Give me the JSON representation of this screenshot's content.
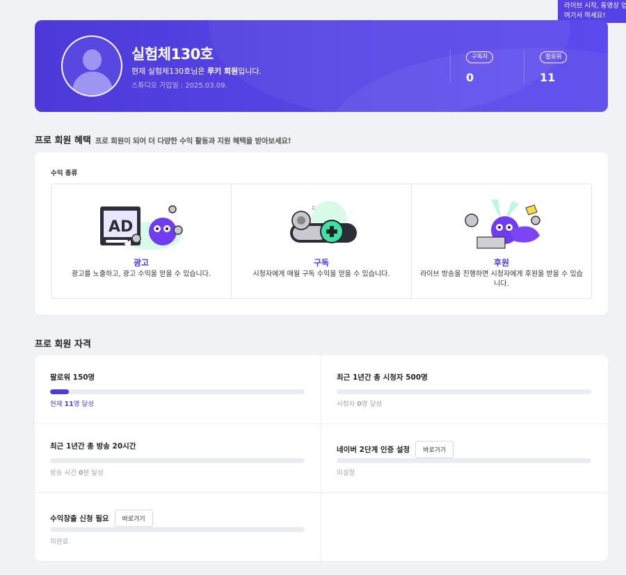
{
  "tooltip": {
    "line1": "라이브 시작, 동영상 업",
    "line2": "여기서 하세요!"
  },
  "profile": {
    "name": "실험체130호",
    "desc_prefix": "현재 실험체130호님은 ",
    "desc_grade": "루키 회원",
    "desc_suffix": "입니다.",
    "joined": "스튜디오 가입일 : 2025.03.09.",
    "stats": [
      {
        "label": "구독자",
        "value": "0"
      },
      {
        "label": "팔로워",
        "value": "11"
      }
    ]
  },
  "benefits": {
    "title": "프로 회원 혜택",
    "subtitle": "프로 회원이 되어 더 다양한 수익 활동과 지원 혜택을 받아보세요!",
    "revenue_label": "수익 종류",
    "items": [
      {
        "name": "광고",
        "desc": "광고를 노출하고, 광고 수익을 얻을 수 있습니다.",
        "icon": "ad-monitor-icon"
      },
      {
        "name": "구독",
        "desc": "시청자에게 매월 구독 수익을 얻을 수 있습니다.",
        "icon": "subscribe-toggle-icon"
      },
      {
        "name": "후원",
        "desc": "라이브 방송을 진행하면 시청자에게 후원을 받을 수 있습니다.",
        "icon": "donation-icon"
      }
    ]
  },
  "qualification": {
    "title": "프로 회원 자격",
    "go_label": "바로가기",
    "items": [
      {
        "title": "팔로워 150명",
        "status_prefix": "현재 ",
        "status_num": "11",
        "status_suffix": "명 달성",
        "progress": 0.073,
        "active": true,
        "has_button": false
      },
      {
        "title": "최근 1년간 총 시청자 500명",
        "status_prefix": "시청자 ",
        "status_num": "0",
        "status_suffix": "명 달성",
        "progress": 0,
        "active": false,
        "has_button": false
      },
      {
        "title": "최근 1년간 총 방송 20시간",
        "status_prefix": "방송 시간 ",
        "status_num": "0",
        "status_suffix": "분 달성",
        "progress": 0,
        "active": false,
        "has_button": false
      },
      {
        "title": "네이버 2단계 인증 설정",
        "status_prefix": "미설정",
        "status_num": "",
        "status_suffix": "",
        "progress": 0,
        "active": false,
        "has_button": true
      },
      {
        "title": "수익창출 신청 필요",
        "status_prefix": "미완료",
        "status_num": "",
        "status_suffix": "",
        "progress": 0,
        "active": false,
        "has_button": true
      }
    ]
  },
  "colors": {
    "accent": "#4a3bdc",
    "banner": "#5442e6",
    "mint": "#3ee0a8"
  }
}
